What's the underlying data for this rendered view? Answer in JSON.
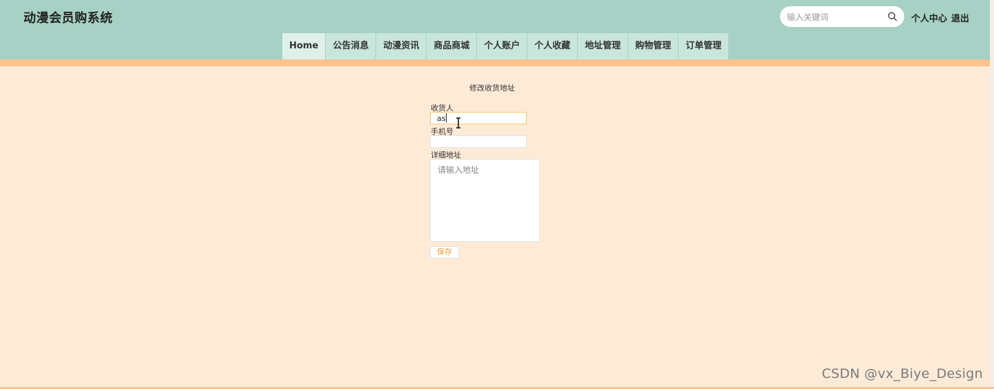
{
  "header": {
    "title": "动漫会员购系统",
    "search": {
      "placeholder": "输入关键词",
      "icon": "search-icon"
    },
    "links": {
      "profile": "个人中心",
      "logout": "退出"
    }
  },
  "nav": {
    "items": [
      "Home",
      "公告消息",
      "动漫资讯",
      "商品商城",
      "个人账户",
      "个人收藏",
      "地址管理",
      "购物管理",
      "订单管理"
    ]
  },
  "form": {
    "title": "修改收货地址",
    "receiver_label": "收货人",
    "receiver_value": "as",
    "phone_label": "手机号",
    "phone_value": "",
    "address_label": "详细地址",
    "address_placeholder": "请输入地址",
    "save_label": "保存"
  },
  "watermark": "CSDN @vx_Biye_Design",
  "colors": {
    "header_bg": "#a6d1c4",
    "accent_bar": "#fbc38d",
    "page_bg": "#fdebd7",
    "save_text": "#f0a03c"
  }
}
